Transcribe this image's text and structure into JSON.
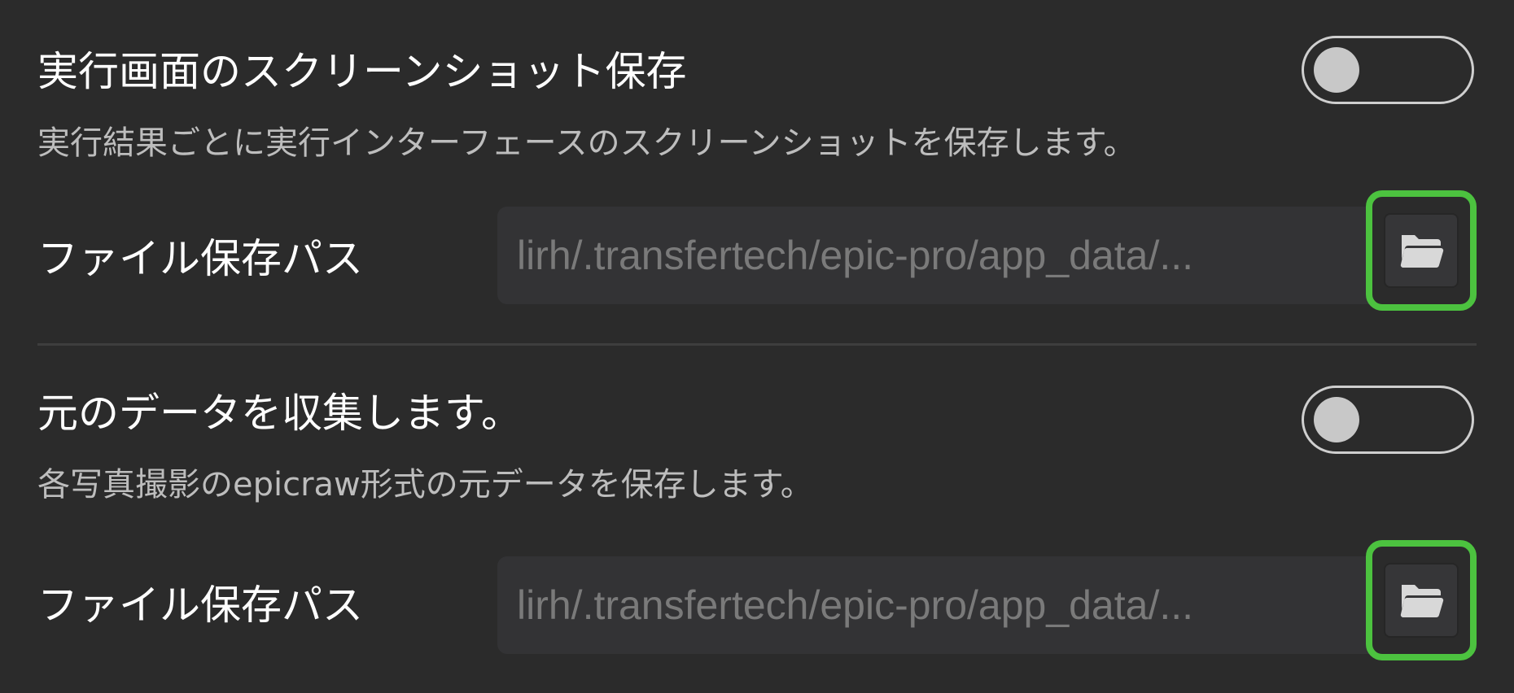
{
  "screenshot_setting": {
    "title": "実行画面のスクリーンショット保存",
    "description": "実行結果ごとに実行インターフェースのスクリーンショットを保存します。",
    "enabled": false,
    "path_label": "ファイル保存パス",
    "path_value": "lirh/.transfertech/epic-pro/app_data/...",
    "folder_icon": "folder-open-icon"
  },
  "raw_data_setting": {
    "title": "元のデータを収集します。",
    "description": "各写真撮影のepicraw形式の元データを保存します。",
    "enabled": false,
    "path_label": "ファイル保存パス",
    "path_value": "lirh/.transfertech/epic-pro/app_data/...",
    "folder_icon": "folder-open-icon"
  },
  "colors": {
    "background": "#2b2b2b",
    "highlight": "#4cc23f",
    "field_background": "#333335",
    "muted_text": "#7a7a7a"
  }
}
